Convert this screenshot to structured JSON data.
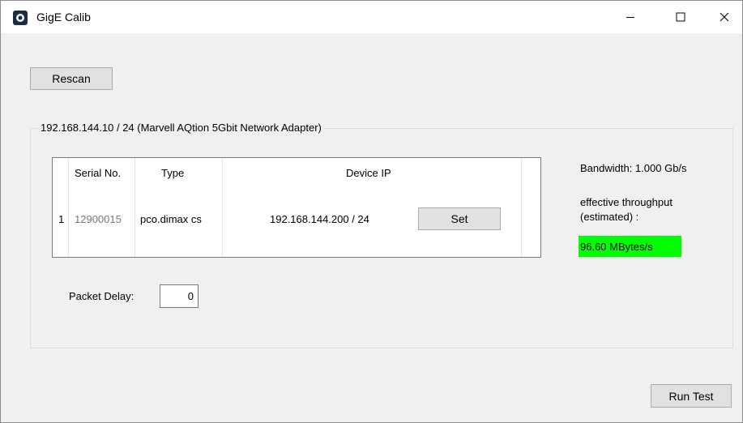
{
  "window": {
    "title": "GigE Calib",
    "icon": "camera-app-icon",
    "controls": {
      "minimize": "—",
      "maximize": "☐",
      "close": "✕"
    }
  },
  "toolbar": {
    "rescan_label": "Rescan"
  },
  "adapter_group": {
    "label": "192.168.144.10 / 24 (Marvell AQtion 5Gbit Network Adapter)",
    "table": {
      "columns": [
        "Serial No.",
        "Type",
        "Device IP"
      ],
      "rows": [
        {
          "row_num": "1",
          "serial": "12900015",
          "type": "pco.dimax cs",
          "ip": "192.168.144.200 / 24",
          "action": "Set"
        }
      ]
    },
    "bandwidth": "Bandwidth: 1.000 Gb/s",
    "throughput_label": "effective throughput (estimated) :",
    "throughput_value": "96.60 MBytes/s",
    "throughput_color": "#00ff00",
    "packet_delay_label": "Packet Delay:",
    "packet_delay_value": "0"
  },
  "footer": {
    "run_test_label": "Run Test"
  }
}
